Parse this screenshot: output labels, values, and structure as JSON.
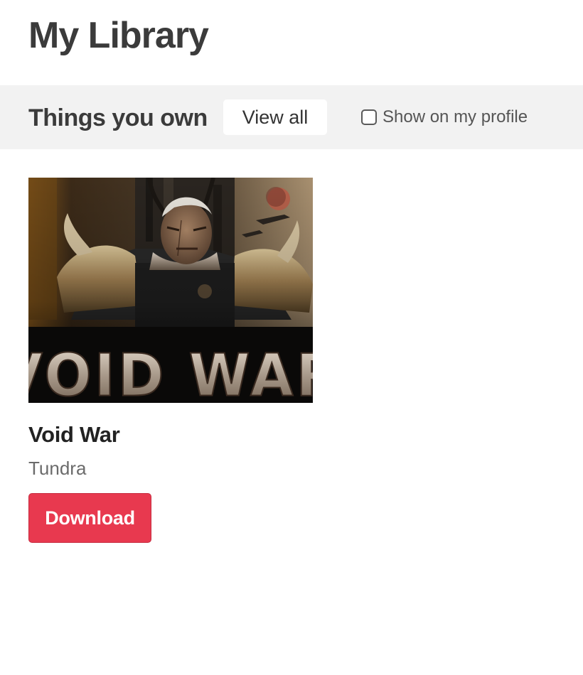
{
  "page": {
    "title": "My Library"
  },
  "section": {
    "title": "Things you own",
    "view_all_label": "View all",
    "show_on_profile_label": "Show on my profile",
    "show_on_profile_checked": false
  },
  "games": [
    {
      "title": "Void War",
      "publisher": "Tundra",
      "cover_logo_text": "VOID WAR",
      "download_label": "Download"
    }
  ],
  "colors": {
    "accent": "#e8394f",
    "section_bg": "#f2f2f2",
    "title_text": "#3b3b3b"
  }
}
